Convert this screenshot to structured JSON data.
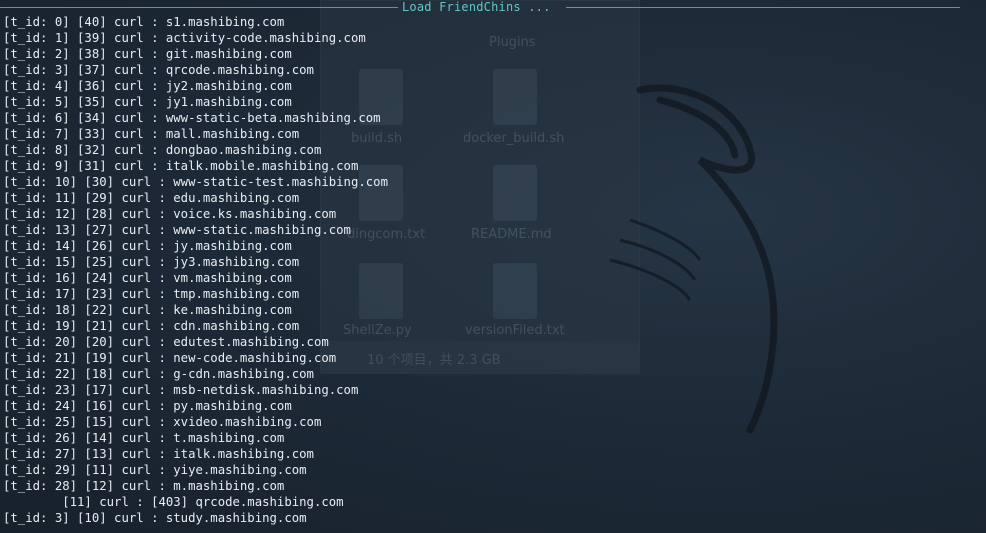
{
  "terminal": {
    "title": "Load FriendChins ...",
    "lines": [
      "[t_id: 0] [40] curl : s1.mashibing.com",
      "[t_id: 1] [39] curl : activity-code.mashibing.com",
      "[t_id: 2] [38] curl : git.mashibing.com",
      "[t_id: 3] [37] curl : qrcode.mashibing.com",
      "[t_id: 4] [36] curl : jy2.mashibing.com",
      "[t_id: 5] [35] curl : jy1.mashibing.com",
      "[t_id: 6] [34] curl : www-static-beta.mashibing.com",
      "[t_id: 7] [33] curl : mall.mashibing.com",
      "[t_id: 8] [32] curl : dongbao.mashibing.com",
      "[t_id: 9] [31] curl : italk.mobile.mashibing.com",
      "[t_id: 10] [30] curl : www-static-test.mashibing.com",
      "[t_id: 11] [29] curl : edu.mashibing.com",
      "[t_id: 12] [28] curl : voice.ks.mashibing.com",
      "[t_id: 13] [27] curl : www-static.mashibing.com",
      "[t_id: 14] [26] curl : jy.mashibing.com",
      "[t_id: 15] [25] curl : jy3.mashibing.com",
      "[t_id: 16] [24] curl : vm.mashibing.com",
      "[t_id: 17] [23] curl : tmp.mashibing.com",
      "[t_id: 18] [22] curl : ke.mashibing.com",
      "[t_id: 19] [21] curl : cdn.mashibing.com",
      "[t_id: 20] [20] curl : edutest.mashibing.com",
      "[t_id: 21] [19] curl : new-code.mashibing.com",
      "[t_id: 22] [18] curl : g-cdn.mashibing.com",
      "[t_id: 23] [17] curl : msb-netdisk.mashibing.com",
      "[t_id: 24] [16] curl : py.mashibing.com",
      "[t_id: 25] [15] curl : xvideo.mashibing.com",
      "[t_id: 26] [14] curl : t.mashibing.com",
      "[t_id: 27] [13] curl : italk.mashibing.com",
      "[t_id: 29] [11] curl : yiye.mashibing.com",
      "[t_id: 28] [12] curl : m.mashibing.com",
      "        [11] curl : [403] qrcode.mashibing.com",
      "[t_id: 3] [10] curl : study.mashibing.com"
    ]
  },
  "background_window": {
    "folder_label": "Plugins",
    "files": [
      {
        "name": "build.sh",
        "icon": "script-file-icon"
      },
      {
        "name": "docker_build.sh",
        "icon": "script-file-icon"
      },
      {
        "name": "dingcom.txt",
        "icon": "text-file-icon"
      },
      {
        "name": "README.md",
        "icon": "markdown-file-icon"
      },
      {
        "name": "ShellZe.py",
        "icon": "python-file-icon"
      },
      {
        "name": "versionFiled.txt",
        "icon": "text-file-icon"
      }
    ],
    "status": "10 个项目，共 2.3 GB"
  },
  "colors": {
    "background": "#1a2633",
    "terminal_text": "#e8edf2",
    "title_accent": "#5fc8c8"
  }
}
